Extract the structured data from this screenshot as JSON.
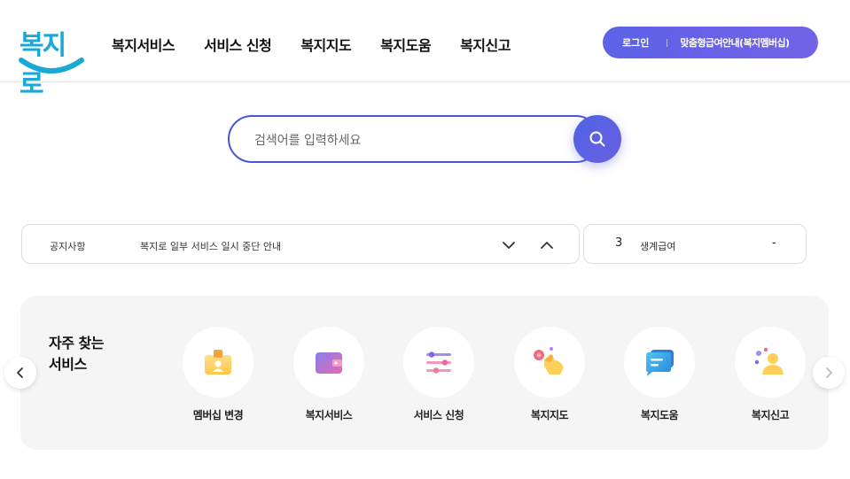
{
  "header": {
    "logo_text": "복지로",
    "nav": [
      {
        "label": "복지서비스"
      },
      {
        "label": "서비스 신청"
      },
      {
        "label": "복지지도"
      },
      {
        "label": "복지도움"
      },
      {
        "label": "복지신고"
      }
    ],
    "login_label": "로그인",
    "guide_label": "맞춤형급여안내(복지멤버십)"
  },
  "search": {
    "placeholder": "검색어를 입력하세요",
    "value": ""
  },
  "notice": {
    "label": "공지사항",
    "text": "복지로 일부 서비스 일시 중단 안내"
  },
  "ranking": {
    "number": "3",
    "text": "생계급여",
    "change": "-"
  },
  "frequent": {
    "title_line1": "자주 찾는",
    "title_line2": "서비스",
    "items": [
      {
        "label": "멤버십 변경",
        "icon": "membership-card-icon"
      },
      {
        "label": "복지서비스",
        "icon": "wallet-icon"
      },
      {
        "label": "서비스 신청",
        "icon": "settings-list-icon"
      },
      {
        "label": "복지지도",
        "icon": "map-pointer-icon"
      },
      {
        "label": "복지도움",
        "icon": "chat-bubble-icon"
      },
      {
        "label": "복지신고",
        "icon": "person-report-icon"
      }
    ]
  },
  "colors": {
    "brand": "#1aa9d6",
    "accent": "#5b63e6"
  }
}
